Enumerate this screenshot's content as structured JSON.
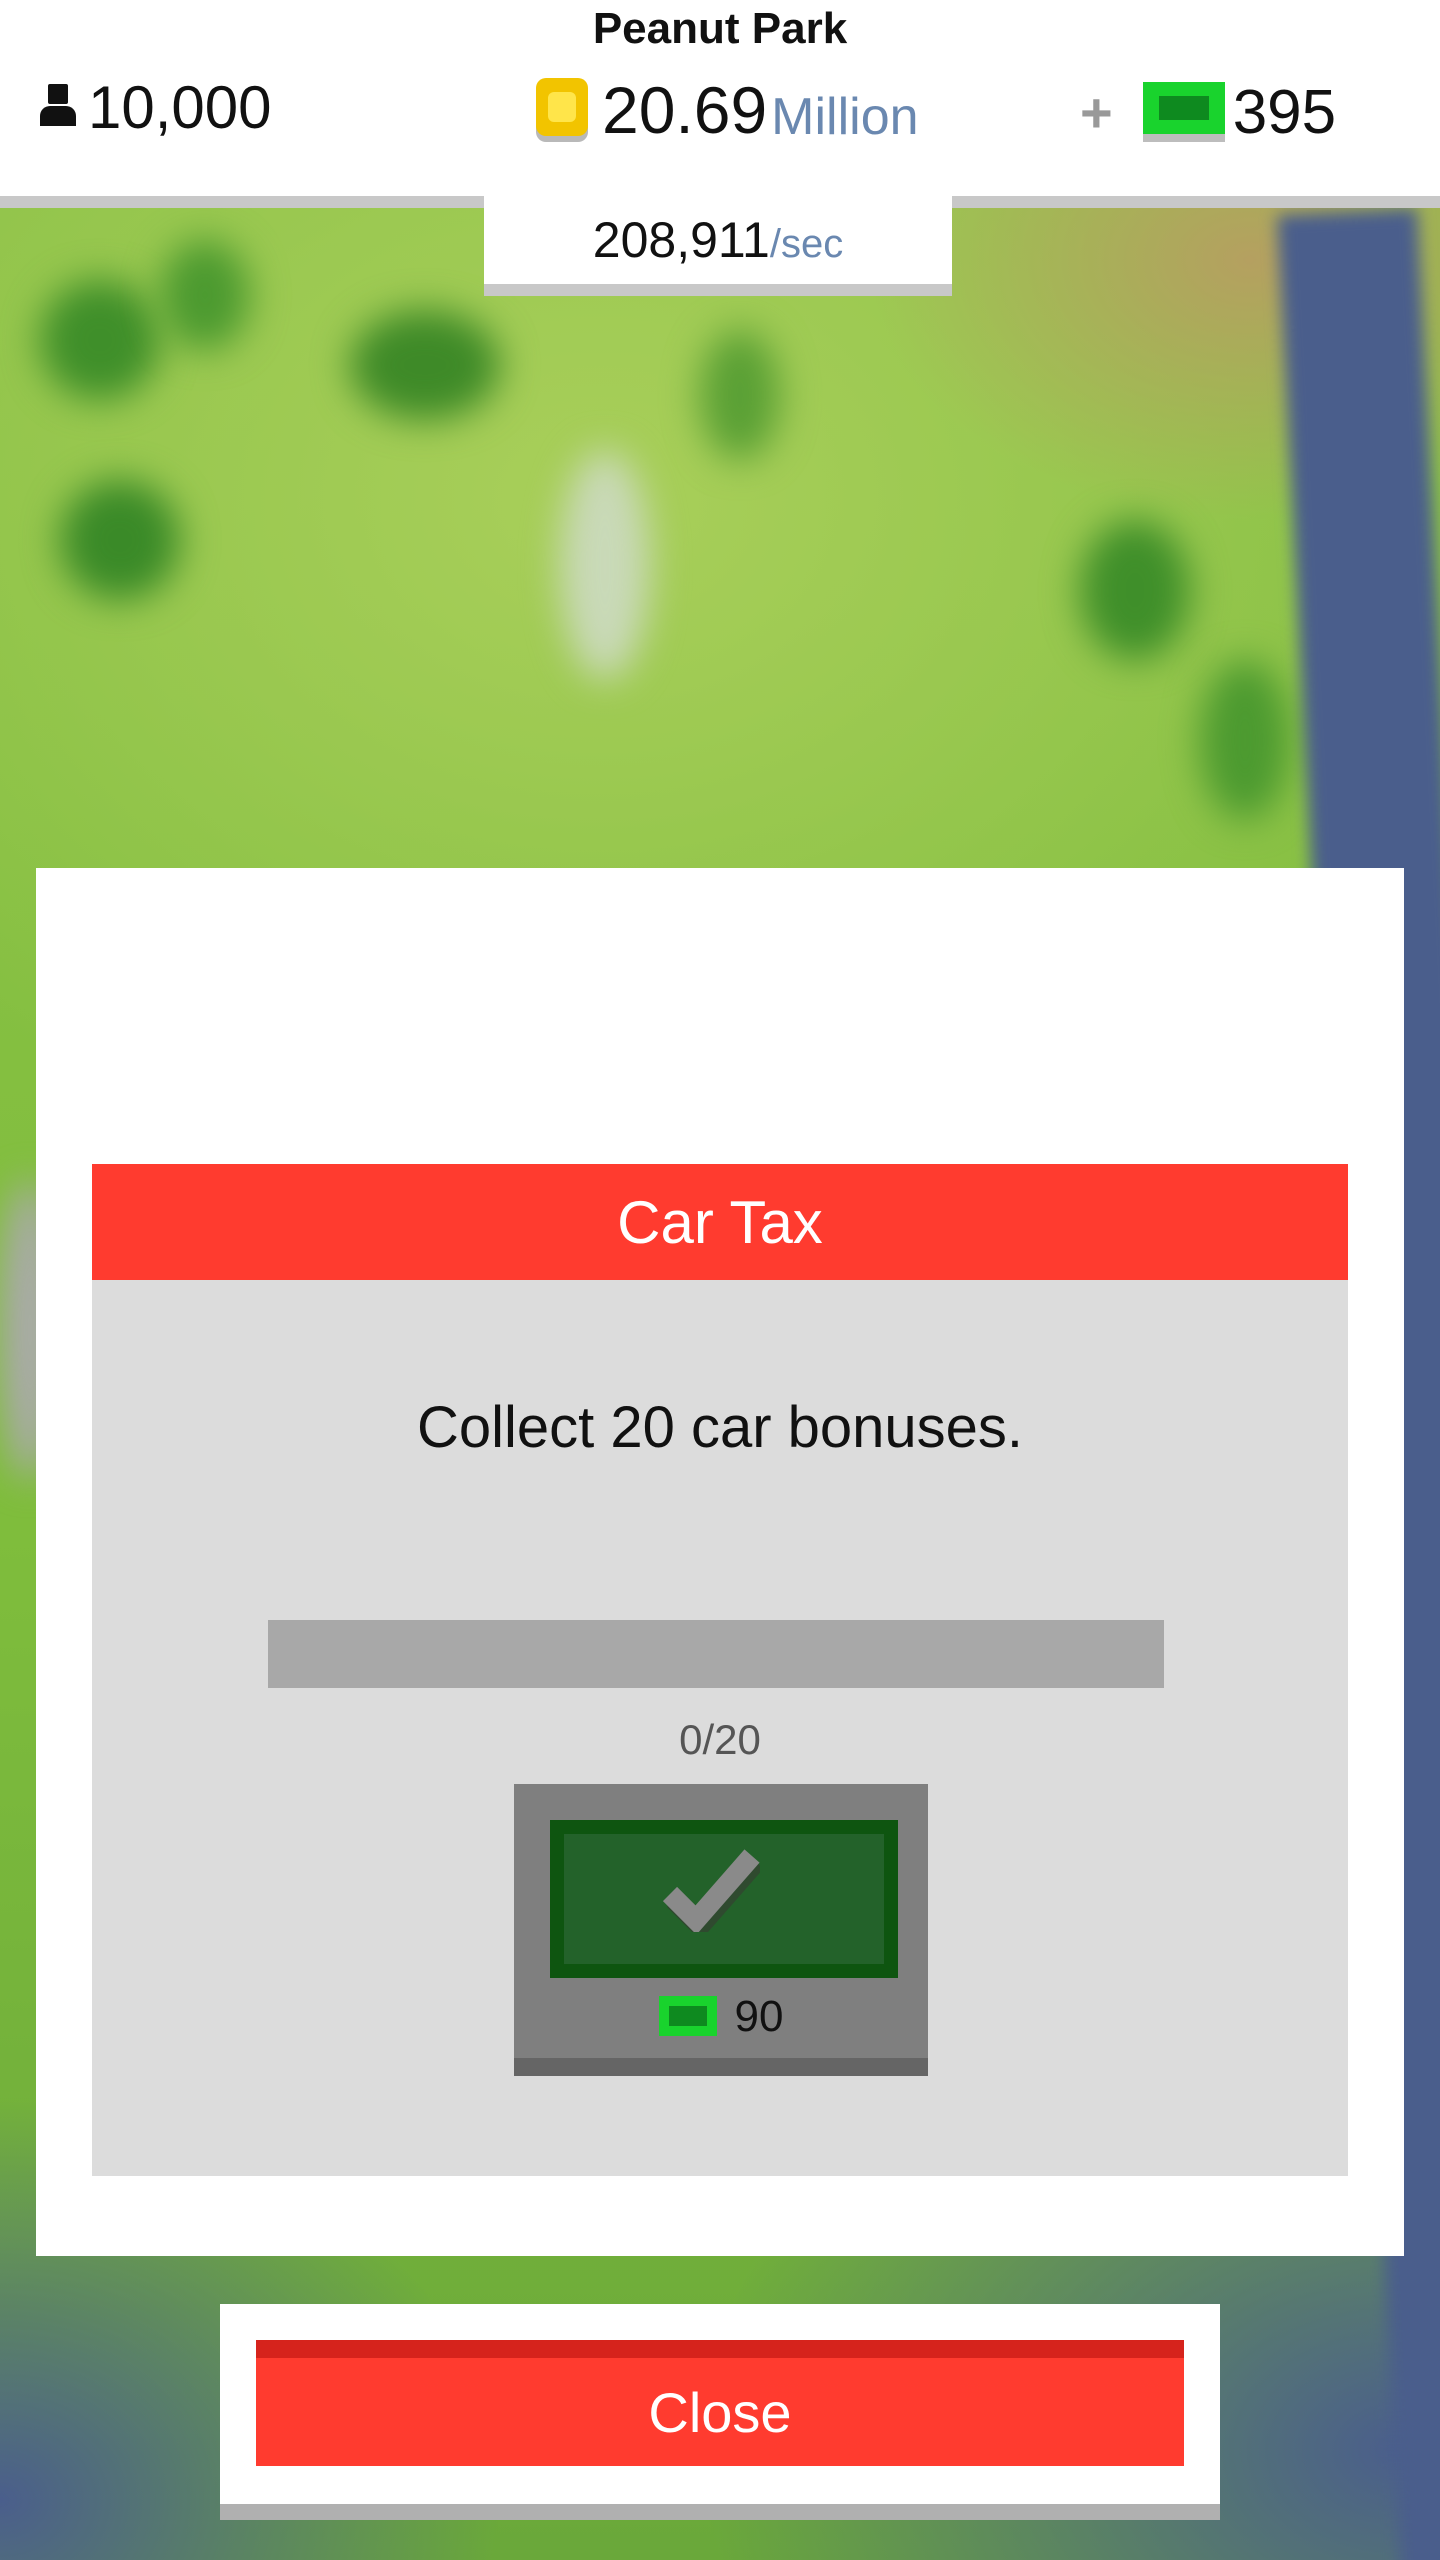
{
  "hud": {
    "park_name": "Peanut Park",
    "population": "10,000",
    "money_value": "20.69",
    "money_unit": "Million",
    "gems_plus": "+",
    "gems": "395",
    "rate_value": "208,911",
    "rate_unit": "/sec",
    "icons": [
      "person-icon",
      "coin-icon",
      "plus-icon",
      "gem-icon"
    ]
  },
  "dialog": {
    "title": "Car Tax",
    "description": "Collect 20 car bonuses.",
    "progress": {
      "current": 0,
      "total": 20,
      "fraction": 0,
      "label": "0/20"
    },
    "claim": {
      "reward": "90",
      "icon": "check-icon",
      "reward_icon": "gem-icon"
    },
    "close_label": "Close"
  },
  "colors": {
    "accent_red": "#ff3b2f",
    "gem_green": "#19d32d",
    "claim_green_dark": "#0e5510",
    "money_unit_blue": "#6a88b0"
  }
}
